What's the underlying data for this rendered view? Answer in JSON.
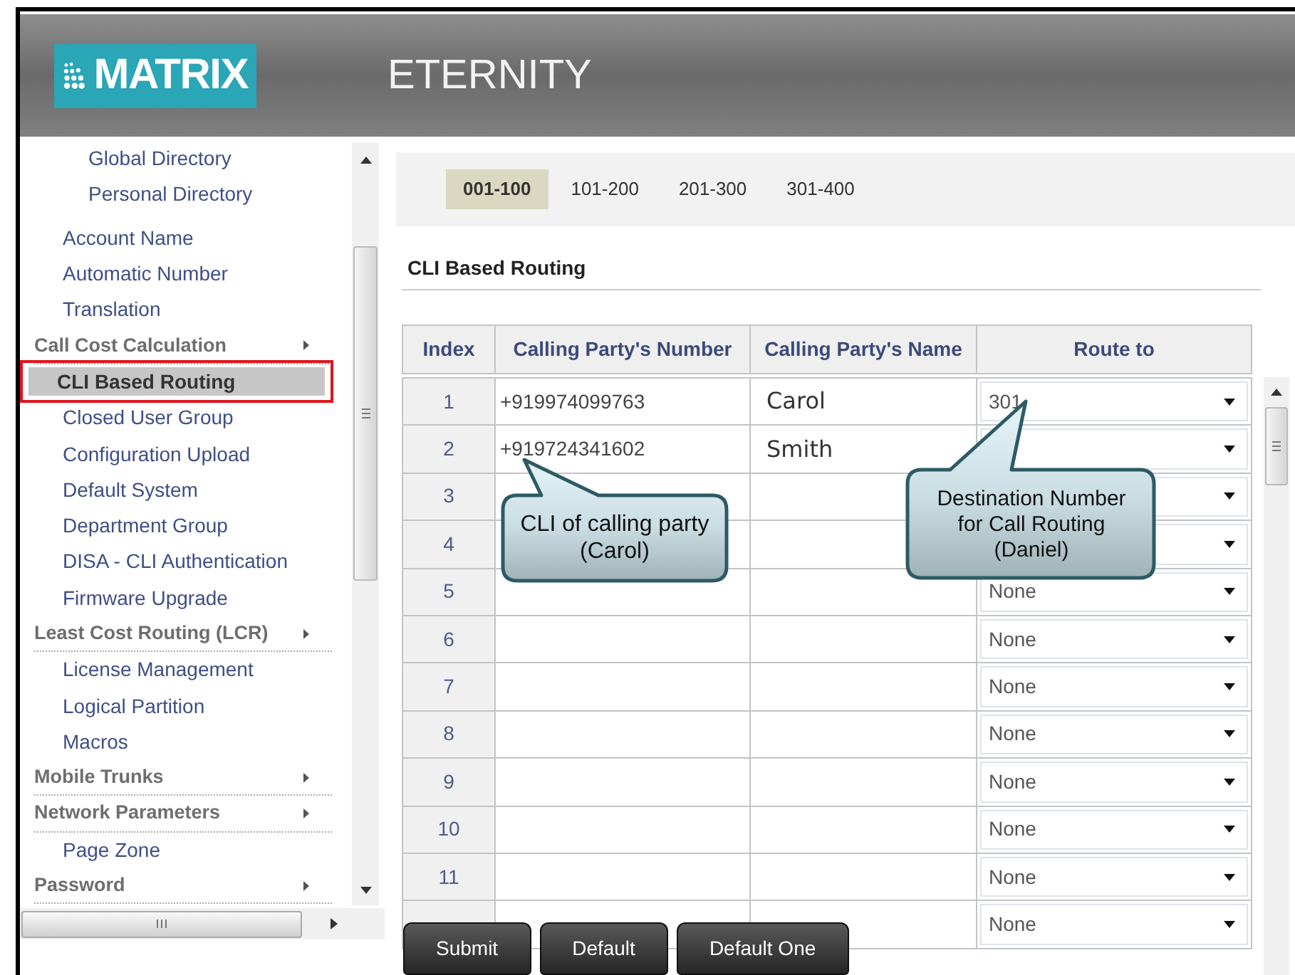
{
  "header": {
    "logo": "MATRIX",
    "product": "ETERNITY"
  },
  "sidebar": {
    "items": [
      {
        "label": "Global Directory",
        "kind": "nested",
        "selected": false
      },
      {
        "label": "Personal Directory",
        "kind": "nested",
        "selected": false
      },
      {
        "label": "Account Name",
        "kind": "item",
        "selected": false
      },
      {
        "label": "Automatic Number",
        "kind": "item",
        "selected": false
      },
      {
        "label": "Translation",
        "kind": "item",
        "selected": false
      },
      {
        "label": "Call Cost Calculation",
        "kind": "group",
        "selected": false
      },
      {
        "label": "CLI Based Routing",
        "kind": "item",
        "selected": true
      },
      {
        "label": "Closed User Group",
        "kind": "item",
        "selected": false
      },
      {
        "label": "Configuration Upload",
        "kind": "item",
        "selected": false
      },
      {
        "label": "Default System",
        "kind": "item",
        "selected": false
      },
      {
        "label": "Department Group",
        "kind": "item",
        "selected": false
      },
      {
        "label": "DISA - CLI Authentication",
        "kind": "item",
        "selected": false
      },
      {
        "label": "Firmware Upgrade",
        "kind": "item",
        "selected": false
      },
      {
        "label": "Least Cost Routing (LCR)",
        "kind": "group",
        "selected": false
      },
      {
        "label": "License Management",
        "kind": "item",
        "selected": false
      },
      {
        "label": "Logical Partition",
        "kind": "item",
        "selected": false
      },
      {
        "label": "Macros",
        "kind": "item",
        "selected": false
      },
      {
        "label": "Mobile Trunks",
        "kind": "group",
        "selected": false
      },
      {
        "label": "Network Parameters",
        "kind": "group",
        "selected": false
      },
      {
        "label": "Page Zone",
        "kind": "item",
        "selected": false
      },
      {
        "label": "Password",
        "kind": "group",
        "selected": false
      }
    ]
  },
  "tabs": [
    {
      "label": "001-100",
      "selected": true
    },
    {
      "label": "101-200",
      "selected": false
    },
    {
      "label": "201-300",
      "selected": false
    },
    {
      "label": "301-400",
      "selected": false
    }
  ],
  "section_title": "CLI Based Routing",
  "table": {
    "columns": [
      "Index",
      "Calling Party's Number",
      "Calling Party's Name",
      "Route to"
    ],
    "rows": [
      {
        "index": "1",
        "number": "+919974099763",
        "name": "Carol",
        "route": "301"
      },
      {
        "index": "2",
        "number": "+919724341602",
        "name": "Smith"
      },
      {
        "index": "3"
      },
      {
        "index": "4"
      },
      {
        "index": "5",
        "route": "None"
      },
      {
        "index": "6",
        "route": "None"
      },
      {
        "index": "7",
        "route": "None"
      },
      {
        "index": "8",
        "route": "None"
      },
      {
        "index": "9",
        "route": "None"
      },
      {
        "index": "10",
        "route": "None"
      },
      {
        "index": "11",
        "route": "None"
      },
      {
        "route": "None"
      }
    ]
  },
  "buttons": [
    "Submit",
    "Default",
    "Default One"
  ],
  "callouts": [
    {
      "text": "CLI of calling party (Carol)"
    },
    {
      "text": "Destination Number for Call Routing (Daniel)"
    }
  ]
}
